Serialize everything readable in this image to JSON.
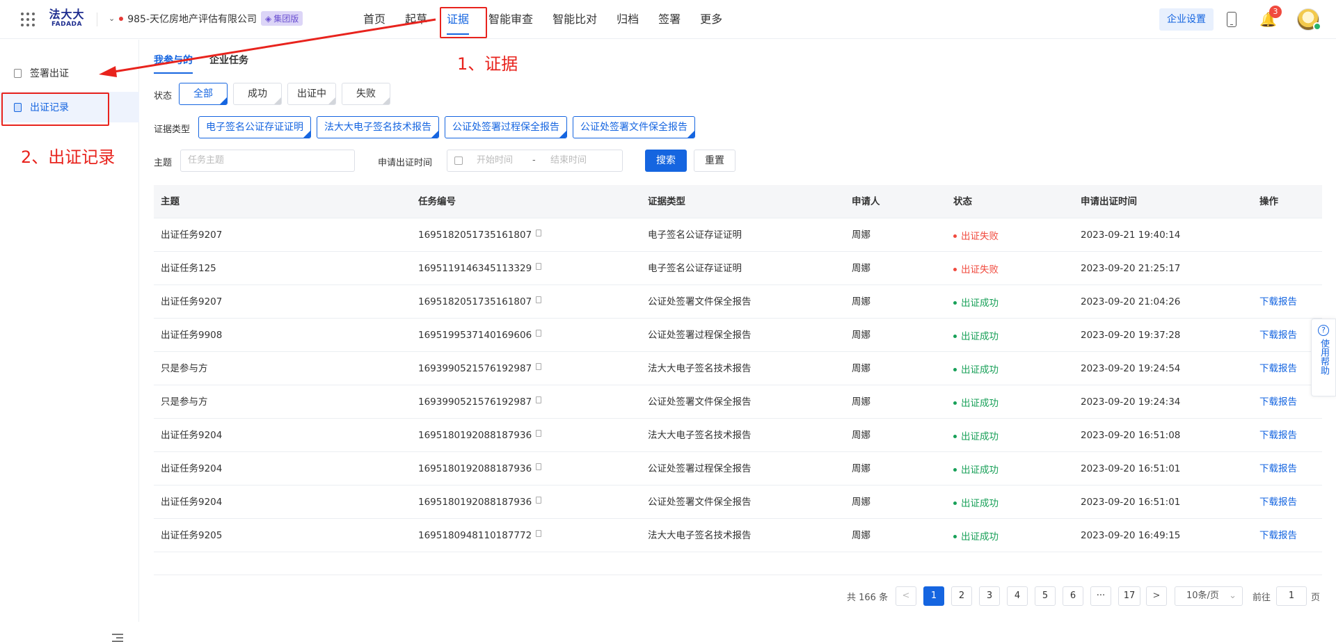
{
  "header": {
    "logo_cn": "法大大",
    "logo_en": "FADADA",
    "company": "985-天亿房地产评估有限公司",
    "tier_badge": "集团版",
    "nav": [
      "首页",
      "起草",
      "证据",
      "智能审查",
      "智能比对",
      "归档",
      "签署",
      "更多"
    ],
    "active_nav": "证据",
    "enterprise_settings": "企业设置",
    "notification_count": "3"
  },
  "sidebar": {
    "items": [
      {
        "label": "签署出证",
        "icon": "document-icon"
      },
      {
        "label": "出证记录",
        "icon": "record-icon"
      }
    ],
    "active_item": "出证记录"
  },
  "tabs": {
    "items": [
      "我参与的",
      "企业任务"
    ],
    "active": "我参与的"
  },
  "filters": {
    "status_label": "状态",
    "status_options": [
      "全部",
      "成功",
      "出证中",
      "失败"
    ],
    "status_selected": "全部",
    "type_label": "证据类型",
    "type_options": [
      "电子签名公证存证证明",
      "法大大电子签名技术报告",
      "公证处签署过程保全报告",
      "公证处签署文件保全报告"
    ],
    "subject_label": "主题",
    "subject_placeholder": "任务主题",
    "time_label": "申请出证时间",
    "start_placeholder": "开始时间",
    "date_separator": "-",
    "end_placeholder": "结束时间",
    "search_button": "搜索",
    "reset_button": "重置"
  },
  "table": {
    "columns": [
      "主题",
      "任务编号",
      "证据类型",
      "申请人",
      "状态",
      "申请出证时间",
      "操作"
    ],
    "rows": [
      {
        "subject": "出证任务9207",
        "task_no": "1695182051735161807",
        "type": "电子签名公证存证证明",
        "applicant": "周娜",
        "status": "出证失败",
        "status_kind": "fail",
        "time": "2023-09-21 19:40:14",
        "action": ""
      },
      {
        "subject": "出证任务125",
        "task_no": "1695119146345113329",
        "type": "电子签名公证存证证明",
        "applicant": "周娜",
        "status": "出证失败",
        "status_kind": "fail",
        "time": "2023-09-20 21:25:17",
        "action": ""
      },
      {
        "subject": "出证任务9207",
        "task_no": "1695182051735161807",
        "type": "公证处签署文件保全报告",
        "applicant": "周娜",
        "status": "出证成功",
        "status_kind": "ok",
        "time": "2023-09-20 21:04:26",
        "action": "下载报告"
      },
      {
        "subject": "出证任务9908",
        "task_no": "1695199537140169606",
        "type": "公证处签署过程保全报告",
        "applicant": "周娜",
        "status": "出证成功",
        "status_kind": "ok",
        "time": "2023-09-20 19:37:28",
        "action": "下载报告"
      },
      {
        "subject": "只是参与方",
        "task_no": "1693990521576192987",
        "type": "法大大电子签名技术报告",
        "applicant": "周娜",
        "status": "出证成功",
        "status_kind": "ok",
        "time": "2023-09-20 19:24:54",
        "action": "下载报告"
      },
      {
        "subject": "只是参与方",
        "task_no": "1693990521576192987",
        "type": "公证处签署文件保全报告",
        "applicant": "周娜",
        "status": "出证成功",
        "status_kind": "ok",
        "time": "2023-09-20 19:24:34",
        "action": "下载报告"
      },
      {
        "subject": "出证任务9204",
        "task_no": "1695180192088187936",
        "type": "法大大电子签名技术报告",
        "applicant": "周娜",
        "status": "出证成功",
        "status_kind": "ok",
        "time": "2023-09-20 16:51:08",
        "action": "下载报告"
      },
      {
        "subject": "出证任务9204",
        "task_no": "1695180192088187936",
        "type": "公证处签署过程保全报告",
        "applicant": "周娜",
        "status": "出证成功",
        "status_kind": "ok",
        "time": "2023-09-20 16:51:01",
        "action": "下载报告"
      },
      {
        "subject": "出证任务9204",
        "task_no": "1695180192088187936",
        "type": "公证处签署文件保全报告",
        "applicant": "周娜",
        "status": "出证成功",
        "status_kind": "ok",
        "time": "2023-09-20 16:51:01",
        "action": "下载报告"
      },
      {
        "subject": "出证任务9205",
        "task_no": "1695180948110187772",
        "type": "法大大电子签名技术报告",
        "applicant": "周娜",
        "status": "出证成功",
        "status_kind": "ok",
        "time": "2023-09-20 16:49:15",
        "action": "下载报告"
      }
    ]
  },
  "pagination": {
    "total": "共 166 条",
    "pages": [
      "1",
      "2",
      "3",
      "4",
      "5",
      "6",
      "···",
      "17"
    ],
    "current": "1",
    "prev": "<",
    "next": ">",
    "page_size": "10条/页",
    "goto_prefix": "前往",
    "goto_value": "1",
    "goto_suffix": "页"
  },
  "help": {
    "label": "使用帮助",
    "icon": "?"
  },
  "annotations": {
    "step1": "1、证据",
    "step2": "2、出证记录"
  },
  "colors": {
    "primary": "#1565e0",
    "fail": "#f04a3e",
    "success": "#18a058",
    "annotation": "#e8231d"
  }
}
